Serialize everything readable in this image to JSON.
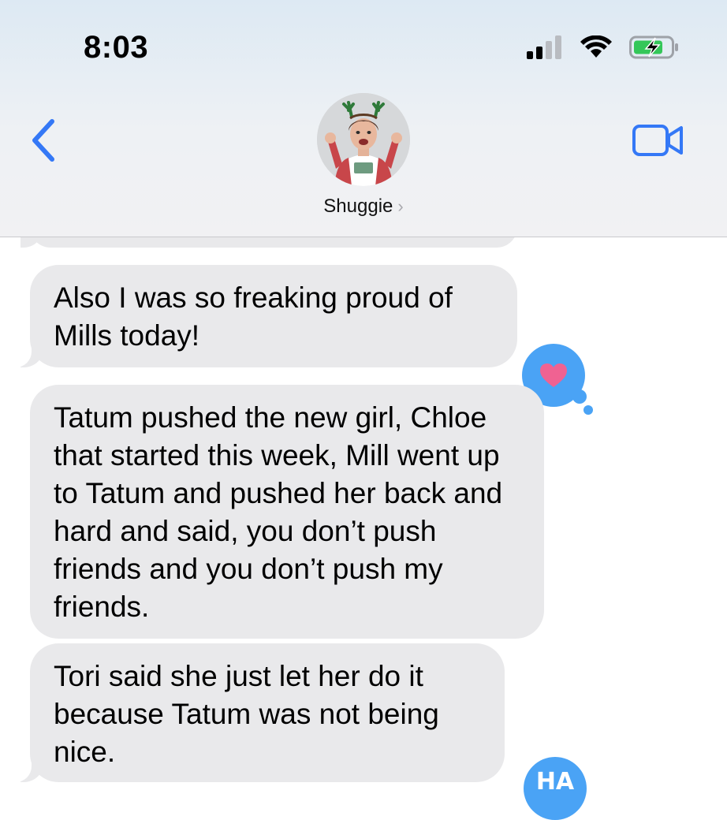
{
  "status_bar": {
    "time": "8:03",
    "signal_icon": "cellular-signal-icon",
    "wifi_icon": "wifi-icon",
    "battery_icon": "battery-charging-icon"
  },
  "header": {
    "back_icon": "chevron-left-icon",
    "contact_name": "Shuggie",
    "name_chevron": "›",
    "video_icon": "video-camera-icon",
    "accent_color": "#3478f6"
  },
  "messages": [
    {
      "text": "Also I was so freaking proud of Mills today!",
      "reaction": "heart"
    },
    {
      "text": "Tatum pushed the new girl, Chloe that started this week, Mill went up to Tatum and pushed her back and hard and said, you don’t push friends and you don’t push my friends.",
      "reaction": ""
    },
    {
      "text": "Tori said she just let her do it because Tatum was not being nice.",
      "reaction": "haha"
    }
  ],
  "colors": {
    "incoming_bubble": "#e9e9eb",
    "reaction_bubble": "#4aa3f5",
    "heart": "#f06292"
  },
  "reactions": {
    "haha_label": "HA"
  }
}
